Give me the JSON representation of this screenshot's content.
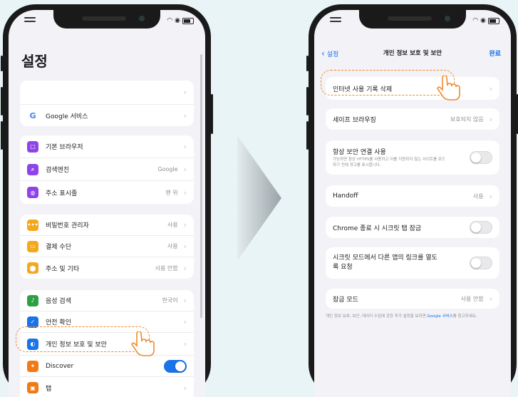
{
  "left_screen": {
    "title": "설정",
    "group1": [
      {
        "label": "",
        "icon": "none"
      },
      {
        "label": "Google 서비스",
        "icon": "google-icon"
      }
    ],
    "group2": [
      {
        "label": "기본 브라우저",
        "value": "",
        "icon": "browser-icon",
        "color": "#8e44e8"
      },
      {
        "label": "검색엔진",
        "value": "Google",
        "icon": "search-icon",
        "color": "#8e44e8"
      },
      {
        "label": "주소 표시줄",
        "value": "맨 위",
        "icon": "address-bar-icon",
        "color": "#8e44e8"
      }
    ],
    "group3": [
      {
        "label": "비밀번호 관리자",
        "value": "사용",
        "icon": "password-icon",
        "color": "#f4a81d"
      },
      {
        "label": "결제 수단",
        "value": "사용",
        "icon": "card-icon",
        "color": "#f4a81d"
      },
      {
        "label": "주소 및 기타",
        "value": "사용 안함",
        "icon": "location-icon",
        "color": "#f4a81d"
      }
    ],
    "group4": [
      {
        "label": "음성 검색",
        "value": "한국어",
        "icon": "mic-icon",
        "color": "#2ea043"
      },
      {
        "label": "안전 확인",
        "value": "",
        "icon": "safety-check-icon",
        "color": "#1a73e8"
      },
      {
        "label": "개인 정보 보호 및 보안",
        "value": "",
        "icon": "privacy-icon",
        "color": "#1a73e8"
      },
      {
        "label": "Discover",
        "value": "",
        "icon": "discover-icon",
        "color": "#f07b16",
        "toggle": true
      },
      {
        "label": "탭",
        "value": "",
        "icon": "tabs-icon",
        "color": "#f07b16"
      }
    ]
  },
  "right_screen": {
    "back_label": "설정",
    "title": "개인 정보 보호 및 보안",
    "done_label": "완료",
    "rows": [
      {
        "label": "인터넷 사용 기록 삭제",
        "value": "",
        "type": "chevron"
      },
      {
        "label": "세이프 브라우징",
        "value": "보호되지 않음",
        "type": "chevron"
      },
      {
        "label": "항상 보안 연결 사용",
        "sub": "가능하면 항상 HTTPS를 사용하고 이를 지원하지 않는 사이트를 로드하기 전에 경고를 표시합니다.",
        "type": "toggle"
      },
      {
        "label": "Handoff",
        "value": "사용",
        "type": "chevron"
      },
      {
        "label": "Chrome 종료 시 시크릿 탭 잠금",
        "type": "toggle"
      },
      {
        "label": "시크릿 모드에서 다른 앱의 링크를 열도록 요청",
        "type": "toggle"
      },
      {
        "label": "잠금 모드",
        "value": "사용 안함",
        "type": "chevron"
      }
    ],
    "footer_text": "개인 정보 보호, 보안, 데이터 수집에 관한 추가 설정을 보려면 ",
    "footer_link": "Google 서비스",
    "footer_tail": "를 참고하세요."
  },
  "status_bar": {
    "wifi": "wifi-icon",
    "battery": "battery-icon"
  },
  "colors": {
    "accent": "#1a73e8",
    "highlight": "#f08a2c"
  }
}
